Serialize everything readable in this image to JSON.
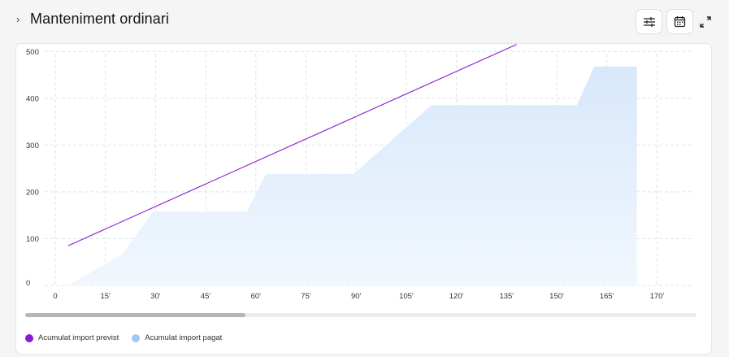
{
  "header": {
    "chevron": "›",
    "title": "Manteniment ordinari"
  },
  "toolbar": {
    "filter_icon": "sliders-icon",
    "calendar_icon": "calendar-icon",
    "expand_icon": "expand-icon"
  },
  "colors": {
    "previst": "#8b1bd1",
    "pagat": "#9ec8f5",
    "area_top": "#d8e8fb",
    "area_bottom": "#f1f7fe"
  },
  "chart_data": {
    "type": "line",
    "x_tick_labels": [
      "0",
      "15'",
      "30'",
      "45'",
      "60'",
      "75'",
      "90'",
      "105'",
      "120'",
      "135'",
      "150'",
      "165'",
      "170'"
    ],
    "y_ticks": [
      0,
      100,
      200,
      300,
      400,
      500
    ],
    "ylim": [
      0,
      530
    ],
    "grid": true,
    "legend_position": "bottom-left",
    "series": [
      {
        "name": "Acumulat import previst",
        "type": "line",
        "color": "#8b1bd1",
        "points": [
          [
            0.26,
            85
          ],
          [
            9.2,
            515
          ]
        ]
      },
      {
        "name": "Acumulat import pagat",
        "type": "area",
        "color": "#9ec8f5",
        "points": [
          [
            0.26,
            0
          ],
          [
            1.35,
            68
          ],
          [
            1.95,
            158
          ],
          [
            3.82,
            158
          ],
          [
            4.2,
            238
          ],
          [
            5.95,
            238
          ],
          [
            7.5,
            385
          ],
          [
            10.4,
            385
          ],
          [
            10.75,
            468
          ],
          [
            11.6,
            468
          ],
          [
            11.6,
            0
          ]
        ]
      }
    ]
  },
  "legend": {
    "items": [
      {
        "label": "Acumulat import previst"
      },
      {
        "label": "Acumulat import pagat"
      }
    ]
  }
}
